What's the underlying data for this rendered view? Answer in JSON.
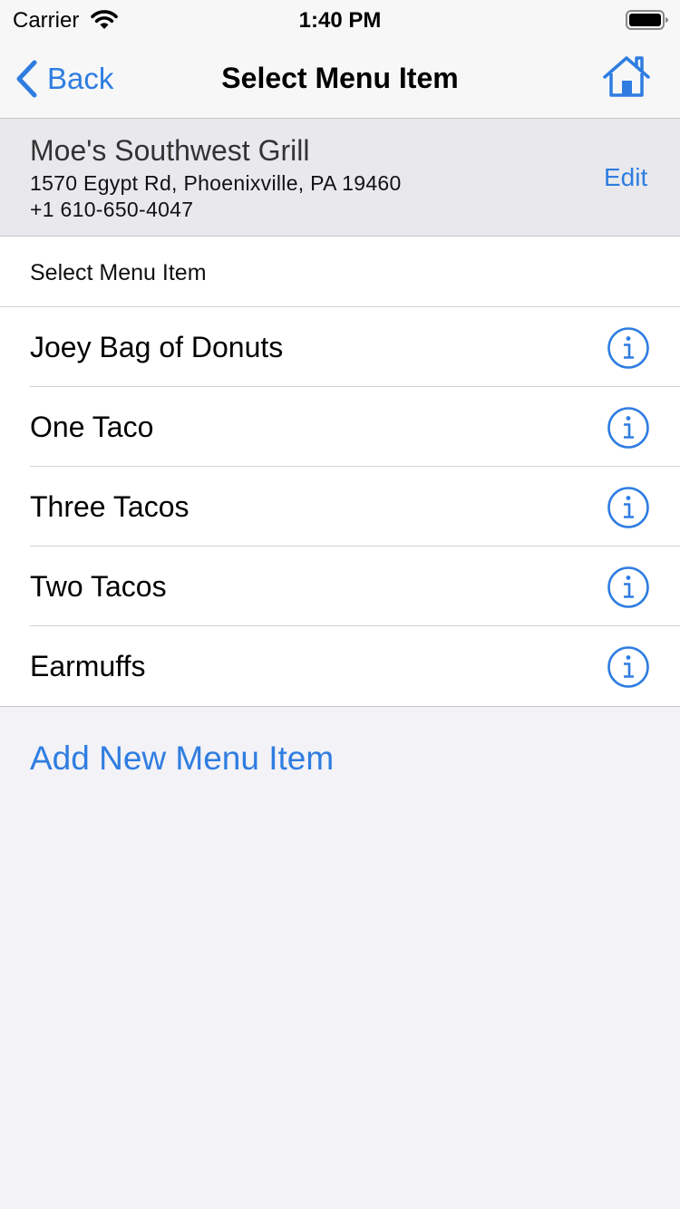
{
  "status": {
    "carrier": "Carrier",
    "time": "1:40 PM"
  },
  "nav": {
    "back_label": "Back",
    "title": "Select Menu Item"
  },
  "restaurant": {
    "name": "Moe's Southwest Grill",
    "address": "1570 Egypt Rd, Phoenixville, PA 19460",
    "phone": "+1 610-650-4047",
    "edit_label": "Edit"
  },
  "list": {
    "header": "Select Menu Item",
    "items": [
      {
        "label": "Joey Bag of Donuts"
      },
      {
        "label": "One Taco"
      },
      {
        "label": "Three Tacos"
      },
      {
        "label": "Two Tacos"
      },
      {
        "label": "Earmuffs"
      }
    ]
  },
  "add_label": "Add New Menu Item",
  "colors": {
    "accent": "#2f7de1",
    "background": "#f2f2f7",
    "header_bg": "#e9e9ed"
  },
  "icons": [
    "wifi-icon",
    "battery-icon",
    "back-chevron-icon",
    "home-icon",
    "info-icon"
  ]
}
